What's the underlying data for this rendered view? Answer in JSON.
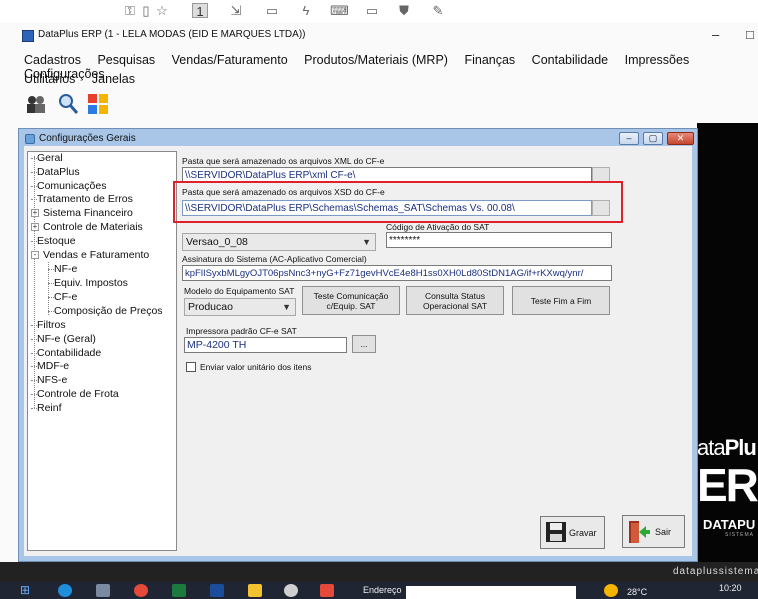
{
  "window": {
    "title": "DataPlus ERP (1 - LELA MODAS  (EID E MARQUES LTDA))",
    "minimize": "–",
    "maximize": "□"
  },
  "menu": {
    "row1": [
      "Cadastros",
      "Pesquisas",
      "Vendas/Faturamento",
      "Produtos/Materiais (MRP)",
      "Finanças",
      "Contabilidade",
      "Impressões",
      "Configurações"
    ],
    "row2": [
      "Utilitários",
      "Janelas"
    ]
  },
  "dialog": {
    "title": "Configurações Gerais",
    "minimize": "–",
    "restore": "▢",
    "close": "✕"
  },
  "tree": {
    "items": [
      {
        "label": "Geral",
        "level": 0
      },
      {
        "label": "DataPlus",
        "level": 0
      },
      {
        "label": "Comunicações",
        "level": 0
      },
      {
        "label": "Tratamento de Erros",
        "level": 0
      },
      {
        "label": "Sistema Financeiro",
        "level": 0,
        "expander": "+"
      },
      {
        "label": "Controle de Materiais",
        "level": 0,
        "expander": "+"
      },
      {
        "label": "Estoque",
        "level": 0
      },
      {
        "label": "Vendas e Faturamento",
        "level": 0,
        "expander": "-"
      },
      {
        "label": "NF-e",
        "level": 1
      },
      {
        "label": "Equiv. Impostos",
        "level": 1
      },
      {
        "label": "CF-e",
        "level": 1
      },
      {
        "label": "Composição de Preços",
        "level": 1
      },
      {
        "label": "Filtros",
        "level": 0
      },
      {
        "label": "NF-e (Geral)",
        "level": 0
      },
      {
        "label": "Contabilidade",
        "level": 0
      },
      {
        "label": "MDF-e",
        "level": 0
      },
      {
        "label": "NFS-e",
        "level": 0
      },
      {
        "label": "Controle de Frota",
        "level": 0
      },
      {
        "label": "Reinf",
        "level": 0
      }
    ]
  },
  "form": {
    "xml_label": "Pasta que será amazenado os arquivos XML do CF-e",
    "xml_value": "\\\\SERVIDOR\\DataPlus ERP\\xml CF-e\\",
    "xsd_label": "Pasta que será amazenado os arquivos XSD do CF-e",
    "xsd_value": "\\\\SERVIDOR\\DataPlus ERP\\Schemas\\Schemas_SAT\\Schemas Vs. 00.08\\",
    "versao_value": "Versao_0_08",
    "ativacao_label": "Código de Ativação do SAT",
    "ativacao_value": "********",
    "assinatura_label": "Assinatura do Sistema (AC-Aplicativo Comercial)",
    "assinatura_value": "kpFlISyxbMLgyOJT06psNnc3+nyG+Fz71gevHVcE4e8H1ss0XH0Ld80StDN1AG/if+rKXwq/ynr/",
    "modelo_label": "Modelo do Equipamento SAT",
    "modelo_value": "Producao",
    "btn_teste_com": "Teste Comunicação c/Equip. SAT",
    "btn_consulta": "Consulta Status Operacional SAT",
    "btn_teste_fim": "Teste Fim a Fim",
    "impressora_label": "Impressora padrão CF-e SAT",
    "impressora_value": "MP-4200 TH",
    "browse": "...",
    "check_label": "Enviar valor unitário dos itens"
  },
  "actions": {
    "gravar": "Gravar",
    "sair": "Sair"
  },
  "brand": {
    "line1_a": "ata",
    "line1_b": "Plu",
    "line2": "ERI",
    "line3": "DATAPU",
    "line4": "SISTEMA",
    "url": "dataplussistema"
  },
  "taskbar": {
    "endereco": "Endereço",
    "temperature": "28°C",
    "clock": "10:20"
  }
}
